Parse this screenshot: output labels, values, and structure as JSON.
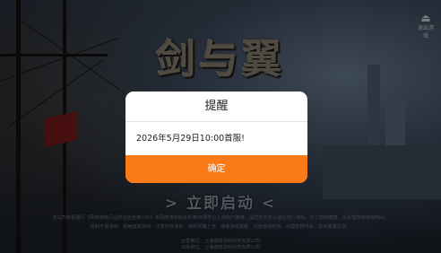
{
  "background": {
    "logo_text": "剑与翼",
    "start_label": "> 立即启动 <",
    "notice_lines": [
      "本公司积极履行《网络游戏行业防沉迷自律公约》本网络游戏适合年满18周岁以上的用户使用，请您在实名认证后进行游戏。为了您的健康，请合理控制游戏时间。",
      "抵制不良游戏，拒绝盗版游戏。注意自我保护，谨防受骗上当。适度游戏益脑，沉迷游戏伤身。合理安排时间，享受健康生活。"
    ],
    "company_lines": [
      "运营单位：上海盛趣游戏科技有限公司",
      "出版单位：上海盛趣游戏科技有限公司"
    ],
    "exit_label": "退出游戏"
  },
  "dialog": {
    "title": "提醒",
    "message": "2026年5月29日10:00首服!",
    "confirm_label": "确定"
  },
  "colors": {
    "confirm_button": "#fb7a18",
    "dialog_bg": "#ffffff",
    "overlay": "rgba(0,0,0,0.42)"
  }
}
